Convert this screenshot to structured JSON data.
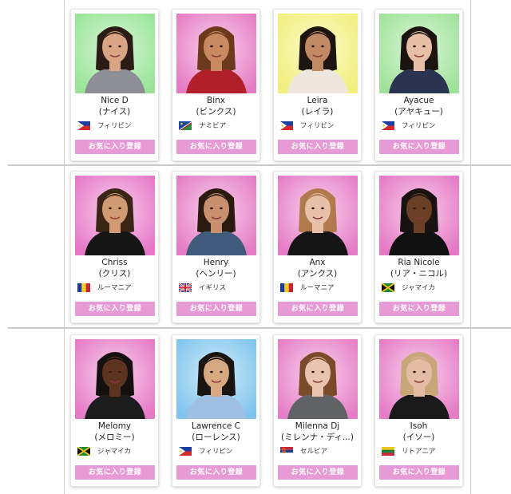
{
  "favorite_label": "お気に入り登録",
  "rows": [
    [
      {
        "name": "Nice D",
        "kana": "(ナイス)",
        "country": "フィリピン",
        "flag": "philippines-flag-icon",
        "bg": [
          "#98e598",
          "#d8f5d8"
        ],
        "hair": "#2b1b15",
        "skin": "#d8a484",
        "shirt": "#8e8e96"
      },
      {
        "name": "Binx",
        "kana": "(ビンクス)",
        "country": "ナミビア",
        "flag": "namibia-flag-icon",
        "bg": [
          "#e67ac4",
          "#f8d4ec"
        ],
        "hair": "#6b3a1c",
        "skin": "#c98a62",
        "shirt": "#b01f2a"
      },
      {
        "name": "Leira",
        "kana": "(レイラ)",
        "country": "フィリピン",
        "flag": "philippines-flag-icon",
        "bg": [
          "#f2ef7e",
          "#fbfac9"
        ],
        "hair": "#1e1410",
        "skin": "#c08a64",
        "shirt": "#efe6dd"
      },
      {
        "name": "Ayacue",
        "kana": "(アヤキュー)",
        "country": "フィリピン",
        "flag": "philippines-flag-icon",
        "bg": [
          "#9fe29a",
          "#dcf6d8"
        ],
        "hair": "#1c1410",
        "skin": "#e6bfa6",
        "shirt": "#2a3350"
      }
    ],
    [
      {
        "name": "Chriss",
        "kana": "(クリス)",
        "country": "ルーマニア",
        "flag": "romania-flag-icon",
        "bg": [
          "#e677c8",
          "#f8d0ec"
        ],
        "hair": "#3a2416",
        "skin": "#d29a72",
        "shirt": "#161616"
      },
      {
        "name": "Henry",
        "kana": "(ヘンリー)",
        "country": "イギリス",
        "flag": "uk-flag-icon",
        "bg": [
          "#e57bc5",
          "#f7d2ea"
        ],
        "hair": "#2a1a10",
        "skin": "#c99070",
        "shirt": "#3f5a7a"
      },
      {
        "name": "Anx",
        "kana": "(アンクス)",
        "country": "ルーマニア",
        "flag": "romania-flag-icon",
        "bg": [
          "#e67bc7",
          "#f7d6ee"
        ],
        "hair": "#b07a4e",
        "skin": "#e6c0a8",
        "shirt": "#151515"
      },
      {
        "name": "Ria Nicole",
        "kana": "(リア・ニコル)",
        "country": "ジャマイカ",
        "flag": "jamaica-flag-icon",
        "bg": [
          "#e678c6",
          "#f6cfe8"
        ],
        "hair": "#1a1210",
        "skin": "#6b3e26",
        "shirt": "#111111"
      }
    ],
    [
      {
        "name": "Melomy",
        "kana": "(メロミー)",
        "country": "ジャマイカ",
        "flag": "jamaica-flag-icon",
        "bg": [
          "#e67ac6",
          "#f7d3ec"
        ],
        "hair": "#151010",
        "skin": "#5e3420",
        "shirt": "#1c1c1c"
      },
      {
        "name": "Lawrence C",
        "kana": "(ローレンス)",
        "country": "フィリピン",
        "flag": "philippines-flag-icon",
        "bg": [
          "#7fc4ee",
          "#d4ecfa"
        ],
        "hair": "#1a1412",
        "skin": "#d6a982",
        "shirt": "#9fc0e3"
      },
      {
        "name": "Milenna Dj",
        "kana": "(ミレンナ・ディ...)",
        "country": "セルビア",
        "flag": "serbia-flag-icon",
        "bg": [
          "#e67dc6",
          "#f7d4ec"
        ],
        "hair": "#7a4a2a",
        "skin": "#e8c4ae",
        "shirt": "#606266"
      },
      {
        "name": "Isoh",
        "kana": "(イソー)",
        "country": "リトアニア",
        "flag": "lithuania-flag-icon",
        "bg": [
          "#e67bc6",
          "#f7d4ec"
        ],
        "hair": "#c7a67a",
        "skin": "#e3bca4",
        "shirt": "#1a1a1a"
      }
    ]
  ]
}
